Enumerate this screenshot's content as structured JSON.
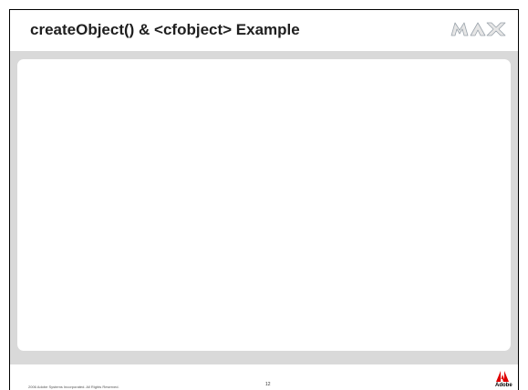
{
  "slide": {
    "title": "createObject() & <cfobject> Example",
    "logo_text": "MAX",
    "footer": {
      "copyright": "2006 Adobe Systems Incorporated. All Rights Reserved.",
      "page_number": "12",
      "brand": "Adobe"
    }
  },
  "colors": {
    "body_background": "#d9d9d9",
    "panel_background": "#ffffff",
    "title_text": "#1f1f1f",
    "adobe_red": "#e00000",
    "max_logo_fill": "#e6e6e6",
    "max_logo_stroke": "#9aa3ab"
  },
  "icons": {
    "max_logo": "max-logo-icon",
    "adobe_logo": "adobe-logo-icon"
  }
}
